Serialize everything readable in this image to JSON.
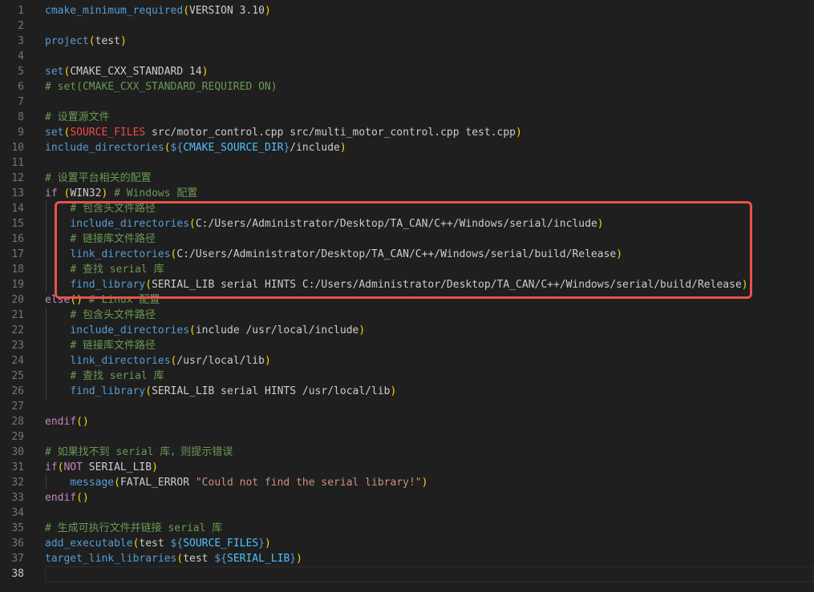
{
  "editor": {
    "current_line": 38,
    "lines": [
      {
        "n": "1",
        "tokens": [
          [
            "fn",
            "cmake_minimum_required"
          ],
          [
            "p",
            "("
          ],
          [
            "id",
            "VERSION 3.10"
          ],
          [
            "p",
            ")"
          ]
        ]
      },
      {
        "n": "2",
        "tokens": []
      },
      {
        "n": "3",
        "tokens": [
          [
            "fn",
            "project"
          ],
          [
            "p",
            "("
          ],
          [
            "id",
            "test"
          ],
          [
            "p",
            ")"
          ]
        ]
      },
      {
        "n": "4",
        "tokens": []
      },
      {
        "n": "5",
        "tokens": [
          [
            "fn",
            "set"
          ],
          [
            "p",
            "("
          ],
          [
            "id",
            "CMAKE_CXX_STANDARD 14"
          ],
          [
            "p",
            ")"
          ]
        ]
      },
      {
        "n": "6",
        "tokens": [
          [
            "cm",
            "# set(CMAKE_CXX_STANDARD_REQUIRED ON)"
          ]
        ]
      },
      {
        "n": "7",
        "tokens": []
      },
      {
        "n": "8",
        "tokens": [
          [
            "cm",
            "# 设置源文件"
          ]
        ]
      },
      {
        "n": "9",
        "tokens": [
          [
            "fn",
            "set"
          ],
          [
            "p",
            "("
          ],
          [
            "var",
            "SOURCE_FILES"
          ],
          [
            "id",
            " src/motor_control.cpp src/multi_motor_control.cpp test.cpp"
          ],
          [
            "p",
            ")"
          ]
        ]
      },
      {
        "n": "10",
        "tokens": [
          [
            "fn",
            "include_directories"
          ],
          [
            "p",
            "("
          ],
          [
            "dv",
            "${"
          ],
          [
            "fn2",
            "CMAKE_SOURCE_DIR"
          ],
          [
            "dv",
            "}"
          ],
          [
            "id",
            "/include"
          ],
          [
            "p",
            ")"
          ]
        ]
      },
      {
        "n": "11",
        "tokens": []
      },
      {
        "n": "12",
        "tokens": [
          [
            "cm",
            "# 设置平台相关的配置"
          ]
        ]
      },
      {
        "n": "13",
        "tokens": [
          [
            "ctl",
            "if"
          ],
          [
            "id",
            " "
          ],
          [
            "p",
            "("
          ],
          [
            "id",
            "WIN32"
          ],
          [
            "p",
            ")"
          ],
          [
            "id",
            " "
          ],
          [
            "cm",
            "# Windows 配置"
          ]
        ]
      },
      {
        "n": "14",
        "tokens": [
          [
            "id",
            "    "
          ],
          [
            "cm",
            "# 包含头文件路径"
          ]
        ]
      },
      {
        "n": "15",
        "tokens": [
          [
            "id",
            "    "
          ],
          [
            "fn",
            "include_directories"
          ],
          [
            "p",
            "("
          ],
          [
            "id",
            "C:/Users/Administrator/Desktop/TA_CAN/C++/Windows/serial/include"
          ],
          [
            "p",
            ")"
          ]
        ]
      },
      {
        "n": "16",
        "tokens": [
          [
            "id",
            "    "
          ],
          [
            "cm",
            "# 链接库文件路径"
          ]
        ]
      },
      {
        "n": "17",
        "tokens": [
          [
            "id",
            "    "
          ],
          [
            "fn",
            "link_directories"
          ],
          [
            "p",
            "("
          ],
          [
            "id",
            "C:/Users/Administrator/Desktop/TA_CAN/C++/Windows/serial/build/Release"
          ],
          [
            "p",
            ")"
          ]
        ]
      },
      {
        "n": "18",
        "tokens": [
          [
            "id",
            "    "
          ],
          [
            "cm",
            "# 查找 serial 库"
          ]
        ]
      },
      {
        "n": "19",
        "tokens": [
          [
            "id",
            "    "
          ],
          [
            "fn",
            "find_library"
          ],
          [
            "p",
            "("
          ],
          [
            "id",
            "SERIAL_LIB serial HINTS C:/Users/Administrator/Desktop/TA_CAN/C++/Windows/serial/build/Release"
          ],
          [
            "p",
            ")"
          ]
        ]
      },
      {
        "n": "20",
        "tokens": [
          [
            "ctl",
            "else"
          ],
          [
            "p",
            "()"
          ],
          [
            "id",
            " "
          ],
          [
            "cm",
            "# Linux 配置"
          ]
        ]
      },
      {
        "n": "21",
        "tokens": [
          [
            "id",
            "    "
          ],
          [
            "cm",
            "# 包含头文件路径"
          ]
        ]
      },
      {
        "n": "22",
        "tokens": [
          [
            "id",
            "    "
          ],
          [
            "fn",
            "include_directories"
          ],
          [
            "p",
            "("
          ],
          [
            "id",
            "include /usr/local/include"
          ],
          [
            "p",
            ")"
          ]
        ]
      },
      {
        "n": "23",
        "tokens": [
          [
            "id",
            "    "
          ],
          [
            "cm",
            "# 链接库文件路径"
          ]
        ]
      },
      {
        "n": "24",
        "tokens": [
          [
            "id",
            "    "
          ],
          [
            "fn",
            "link_directories"
          ],
          [
            "p",
            "("
          ],
          [
            "id",
            "/usr/local/lib"
          ],
          [
            "p",
            ")"
          ]
        ]
      },
      {
        "n": "25",
        "tokens": [
          [
            "id",
            "    "
          ],
          [
            "cm",
            "# 查找 serial 库"
          ]
        ]
      },
      {
        "n": "26",
        "tokens": [
          [
            "id",
            "    "
          ],
          [
            "fn",
            "find_library"
          ],
          [
            "p",
            "("
          ],
          [
            "id",
            "SERIAL_LIB serial HINTS /usr/local/lib"
          ],
          [
            "p",
            ")"
          ]
        ]
      },
      {
        "n": "27",
        "tokens": []
      },
      {
        "n": "28",
        "tokens": [
          [
            "ctl",
            "endif"
          ],
          [
            "p",
            "()"
          ]
        ]
      },
      {
        "n": "29",
        "tokens": []
      },
      {
        "n": "30",
        "tokens": [
          [
            "cm",
            "# 如果找不到 serial 库，则提示错误"
          ]
        ]
      },
      {
        "n": "31",
        "tokens": [
          [
            "ctl",
            "if"
          ],
          [
            "p",
            "("
          ],
          [
            "kw",
            "NOT"
          ],
          [
            "id",
            " SERIAL_LIB"
          ],
          [
            "p",
            ")"
          ]
        ]
      },
      {
        "n": "32",
        "tokens": [
          [
            "id",
            "    "
          ],
          [
            "fn",
            "message"
          ],
          [
            "p",
            "("
          ],
          [
            "id",
            "FATAL_ERROR "
          ],
          [
            "str",
            "\"Could not find the serial library!\""
          ],
          [
            "p",
            ")"
          ]
        ]
      },
      {
        "n": "33",
        "tokens": [
          [
            "ctl",
            "endif"
          ],
          [
            "p",
            "()"
          ]
        ]
      },
      {
        "n": "34",
        "tokens": []
      },
      {
        "n": "35",
        "tokens": [
          [
            "cm",
            "# 生成可执行文件并链接 serial 库"
          ]
        ]
      },
      {
        "n": "36",
        "tokens": [
          [
            "fn",
            "add_executable"
          ],
          [
            "p",
            "("
          ],
          [
            "id",
            "test "
          ],
          [
            "dv",
            "${"
          ],
          [
            "fn2",
            "SOURCE_FILES"
          ],
          [
            "dv",
            "}"
          ],
          [
            "p",
            ")"
          ]
        ]
      },
      {
        "n": "37",
        "tokens": [
          [
            "fn",
            "target_link_libraries"
          ],
          [
            "p",
            "("
          ],
          [
            "id",
            "test "
          ],
          [
            "dv",
            "${"
          ],
          [
            "fn2",
            "SERIAL_LIB"
          ],
          [
            "dv",
            "}"
          ],
          [
            "p",
            ")"
          ]
        ]
      },
      {
        "n": "38",
        "tokens": []
      }
    ]
  },
  "colors": {
    "background": "#1f1f1f",
    "highlight_box": "#e5534b"
  }
}
